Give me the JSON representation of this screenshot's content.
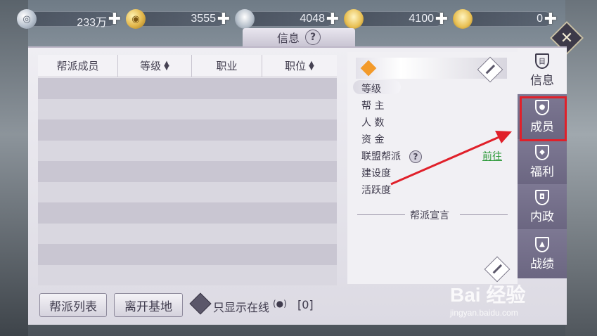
{
  "currencies": [
    {
      "icon": "silver-coin-icon",
      "value": "233万"
    },
    {
      "icon": "gold-coin-icon",
      "value": "3555"
    },
    {
      "icon": "silver-ingot-icon",
      "value": "4048"
    },
    {
      "icon": "gold-ingot-icon",
      "value": "4100"
    },
    {
      "icon": "gold-bar-icon",
      "value": "0"
    }
  ],
  "window": {
    "title": "信息",
    "help": "?"
  },
  "table": {
    "headers": [
      "帮派成员",
      "等级",
      "职业",
      "职位"
    ],
    "sort_icon": "sort-icon"
  },
  "footer": {
    "guild_list": "帮派列表",
    "leave_base": "离开基地",
    "online_only": "只显示在线",
    "online_count": "[0]"
  },
  "info": {
    "fields": [
      "等级",
      "帮 主",
      "人 数",
      "资 金",
      "联盟帮派",
      "建设度",
      "活跃度"
    ],
    "goto": "前往",
    "help": "?",
    "declaration": "帮派宣言"
  },
  "tabs": [
    {
      "label": "信息",
      "active": true
    },
    {
      "label": "成员",
      "highlighted": true
    },
    {
      "label": "福利"
    },
    {
      "label": "内政"
    },
    {
      "label": "战绩"
    }
  ],
  "watermark": {
    "logo": "Bai 经验",
    "url": "jingyan.baidu.com"
  },
  "colors": {
    "highlight": "#e0202a",
    "goto": "#2d9a3a",
    "tab_dark": "#7d7893"
  }
}
